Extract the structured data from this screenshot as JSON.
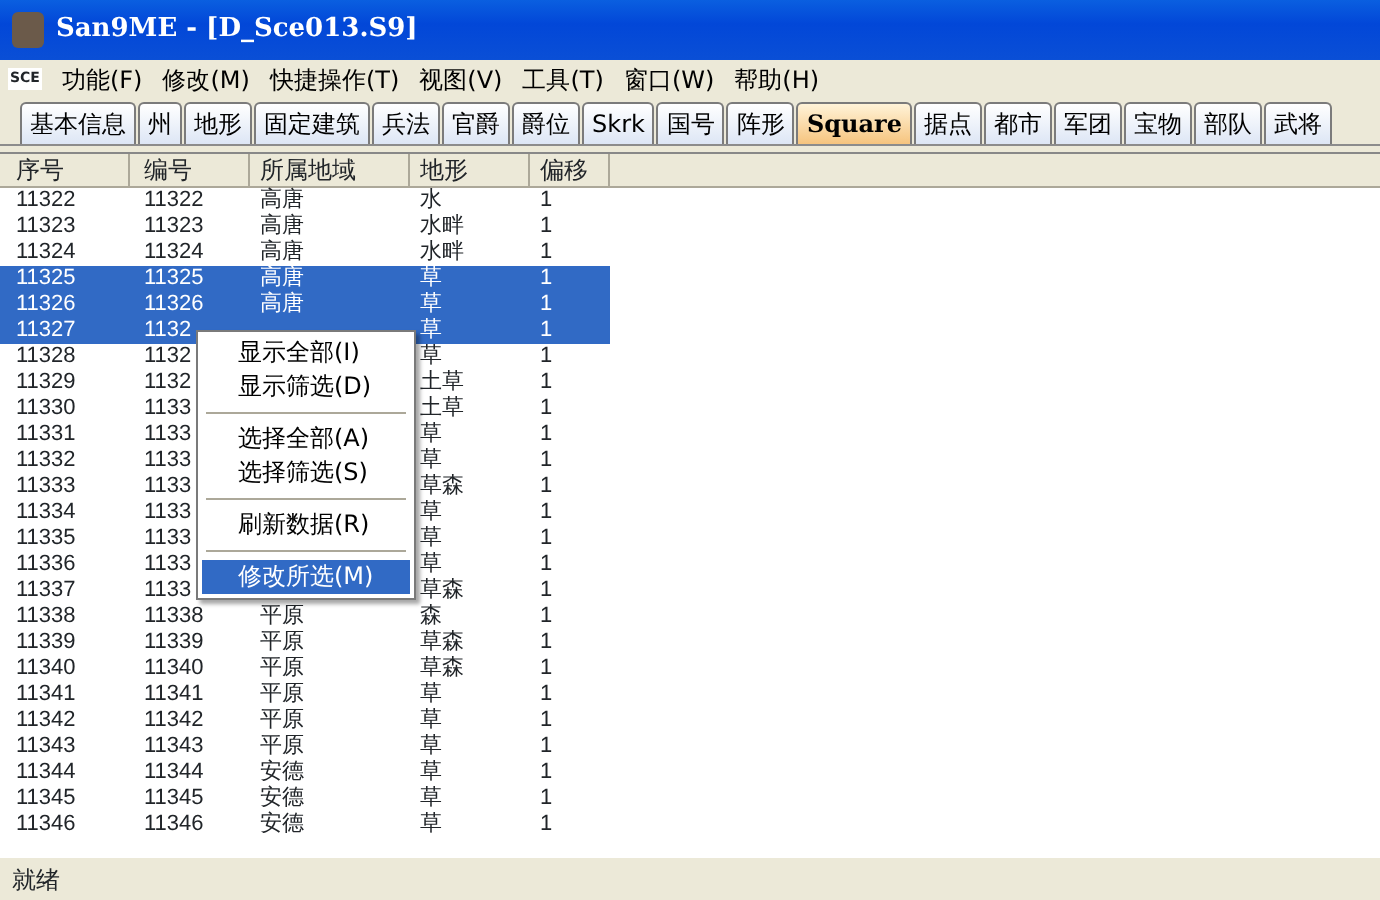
{
  "window": {
    "title": "San9ME - [D_Sce013.S9]"
  },
  "menu_bar": {
    "logo": "SCE",
    "items": [
      "功能(F)",
      "修改(M)",
      "快捷操作(T)",
      "视图(V)",
      "工具(T)",
      "窗口(W)",
      "帮助(H)"
    ]
  },
  "tabs": [
    {
      "label": "基本信息",
      "selected": false
    },
    {
      "label": "州",
      "selected": false
    },
    {
      "label": "地形",
      "selected": false
    },
    {
      "label": "固定建筑",
      "selected": false
    },
    {
      "label": "兵法",
      "selected": false
    },
    {
      "label": "官爵",
      "selected": false
    },
    {
      "label": "爵位",
      "selected": false
    },
    {
      "label": "Skrk",
      "selected": false
    },
    {
      "label": "国号",
      "selected": false
    },
    {
      "label": "阵形",
      "selected": false
    },
    {
      "label": "Square",
      "selected": true
    },
    {
      "label": "据点",
      "selected": false
    },
    {
      "label": "都市",
      "selected": false
    },
    {
      "label": "军团",
      "selected": false
    },
    {
      "label": "宝物",
      "selected": false
    },
    {
      "label": "部队",
      "selected": false
    },
    {
      "label": "武将",
      "selected": false
    }
  ],
  "table": {
    "columns": [
      "序号",
      "编号",
      "所属地域",
      "地形",
      "偏移"
    ],
    "rows": [
      {
        "cells": [
          "11322",
          "11322",
          "高唐",
          "水",
          "1"
        ],
        "selected": false
      },
      {
        "cells": [
          "11323",
          "11323",
          "高唐",
          "水畔",
          "1"
        ],
        "selected": false
      },
      {
        "cells": [
          "11324",
          "11324",
          "高唐",
          "水畔",
          "1"
        ],
        "selected": false
      },
      {
        "cells": [
          "11325",
          "11325",
          "高唐",
          "草",
          "1"
        ],
        "selected": true
      },
      {
        "cells": [
          "11326",
          "11326",
          "高唐",
          "草",
          "1"
        ],
        "selected": true
      },
      {
        "cells": [
          "11327",
          "1132",
          "",
          "草",
          "1"
        ],
        "selected": true
      },
      {
        "cells": [
          "11328",
          "1132",
          "",
          "草",
          "1"
        ],
        "selected": false
      },
      {
        "cells": [
          "11329",
          "1132",
          "",
          "土草",
          "1"
        ],
        "selected": false
      },
      {
        "cells": [
          "11330",
          "1133",
          "",
          "土草",
          "1"
        ],
        "selected": false
      },
      {
        "cells": [
          "11331",
          "1133",
          "",
          "草",
          "1"
        ],
        "selected": false
      },
      {
        "cells": [
          "11332",
          "1133",
          "",
          "草",
          "1"
        ],
        "selected": false
      },
      {
        "cells": [
          "11333",
          "1133",
          "",
          "草森",
          "1"
        ],
        "selected": false
      },
      {
        "cells": [
          "11334",
          "1133",
          "",
          "草",
          "1"
        ],
        "selected": false
      },
      {
        "cells": [
          "11335",
          "1133",
          "",
          "草",
          "1"
        ],
        "selected": false
      },
      {
        "cells": [
          "11336",
          "1133",
          "",
          "草",
          "1"
        ],
        "selected": false
      },
      {
        "cells": [
          "11337",
          "1133",
          "",
          "草森",
          "1"
        ],
        "selected": false
      },
      {
        "cells": [
          "11338",
          "11338",
          "平原",
          "森",
          "1"
        ],
        "selected": false
      },
      {
        "cells": [
          "11339",
          "11339",
          "平原",
          "草森",
          "1"
        ],
        "selected": false
      },
      {
        "cells": [
          "11340",
          "11340",
          "平原",
          "草森",
          "1"
        ],
        "selected": false
      },
      {
        "cells": [
          "11341",
          "11341",
          "平原",
          "草",
          "1"
        ],
        "selected": false
      },
      {
        "cells": [
          "11342",
          "11342",
          "平原",
          "草",
          "1"
        ],
        "selected": false
      },
      {
        "cells": [
          "11343",
          "11343",
          "平原",
          "草",
          "1"
        ],
        "selected": false
      },
      {
        "cells": [
          "11344",
          "11344",
          "安德",
          "草",
          "1"
        ],
        "selected": false
      },
      {
        "cells": [
          "11345",
          "11345",
          "安德",
          "草",
          "1"
        ],
        "selected": false
      },
      {
        "cells": [
          "11346",
          "11346",
          "安德",
          "草",
          "1"
        ],
        "selected": false
      }
    ]
  },
  "context_menu": {
    "items": [
      {
        "kind": "item",
        "label": "显示全部(I)",
        "selected": false
      },
      {
        "kind": "item",
        "label": "显示筛选(D)",
        "selected": false
      },
      {
        "kind": "separator"
      },
      {
        "kind": "item",
        "label": "选择全部(A)",
        "selected": false
      },
      {
        "kind": "item",
        "label": "选择筛选(S)",
        "selected": false
      },
      {
        "kind": "separator"
      },
      {
        "kind": "item",
        "label": "刷新数据(R)",
        "selected": false
      },
      {
        "kind": "separator"
      },
      {
        "kind": "item",
        "label": "修改所选(M)",
        "selected": true
      }
    ]
  },
  "status_bar": {
    "text": "就绪"
  }
}
